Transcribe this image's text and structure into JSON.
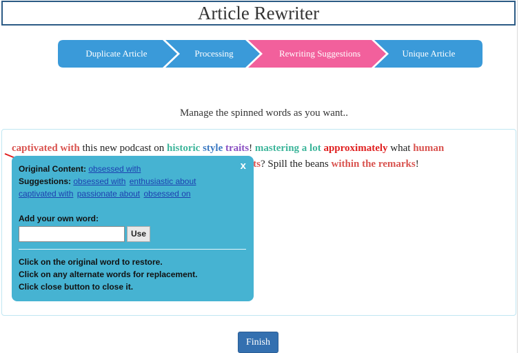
{
  "page": {
    "title": "Article Rewriter",
    "subtitle": "Manage the spinned words as you want.."
  },
  "steps": [
    {
      "label": "Duplicate Article",
      "color": "#3a9ad9",
      "active": false
    },
    {
      "label": "Processing",
      "color": "#3a9ad9",
      "active": false
    },
    {
      "label": "Rewriting Suggestions",
      "color": "#f2609c",
      "active": true
    },
    {
      "label": "Unique Article",
      "color": "#3a9ad9",
      "active": false
    }
  ],
  "article": {
    "line1": {
      "w1": "captivated with",
      "t1": " this new podcast on ",
      "w2": "historic",
      "w3": "style",
      "w4": "traits",
      "t2": "! ",
      "w5": "mastering a lot",
      "w6": "approximately",
      "t3": " what ",
      "w7": "human"
    },
    "line2": {
      "frag": "its",
      "t1": "? Spill the beans ",
      "w1": "within the remarks",
      "t2": "!"
    }
  },
  "popup": {
    "close_label": "x",
    "original_label": "Original Content:",
    "original_value": "obsessed with",
    "suggestions_label": "Suggestions:",
    "suggestions": [
      "obsessed with",
      "enthusiastic about",
      "captivated with",
      "passionate about",
      "obsessed on"
    ],
    "add_label": "Add your own word:",
    "input_value": "",
    "use_label": "Use",
    "help": [
      "Click on the original word to restore.",
      "Click on any alternate words for replacement.",
      "Click close button to close it."
    ]
  },
  "finish_label": "Finish",
  "colors": {
    "popup_bg": "#46b3d2",
    "finish_bg": "#3470b0",
    "title_border": "#2b5a84"
  }
}
